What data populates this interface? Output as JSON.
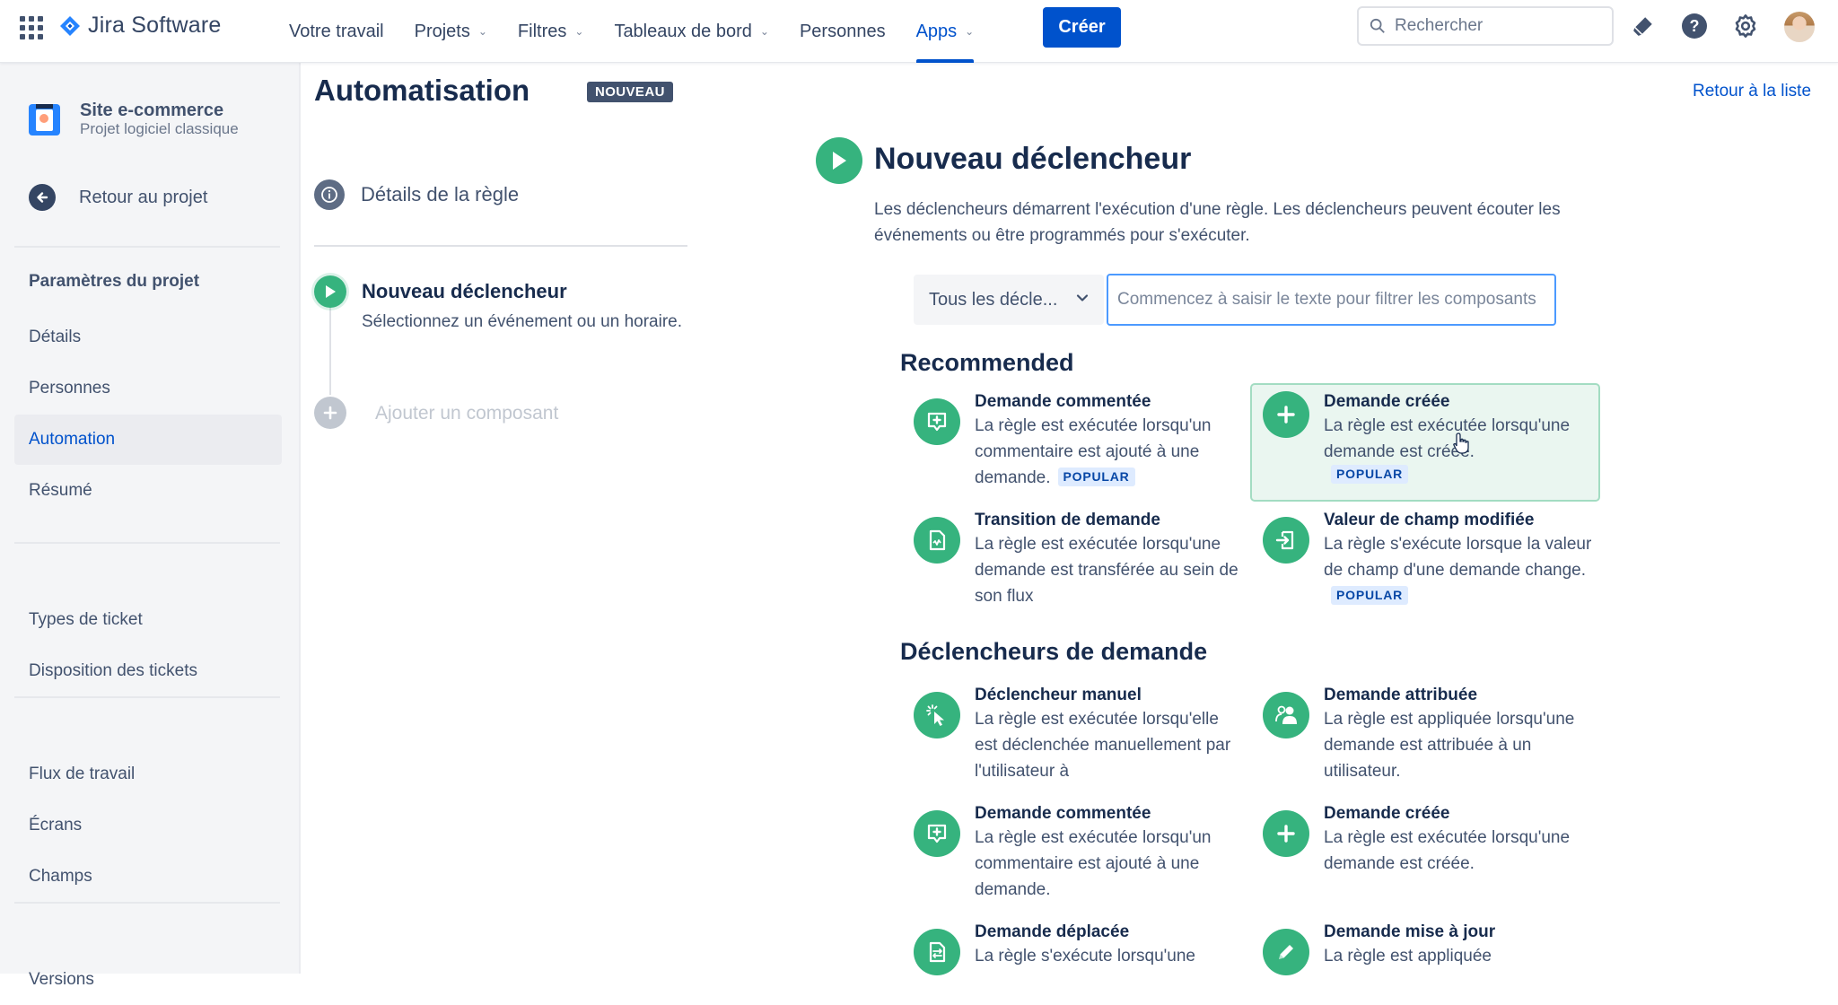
{
  "topnav": {
    "app_name": "Jira Software",
    "items": [
      {
        "label": "Votre travail",
        "dropdown": false,
        "active": false
      },
      {
        "label": "Projets",
        "dropdown": true,
        "active": false
      },
      {
        "label": "Filtres",
        "dropdown": true,
        "active": false
      },
      {
        "label": "Tableaux de bord",
        "dropdown": true,
        "active": false
      },
      {
        "label": "Personnes",
        "dropdown": false,
        "active": false
      },
      {
        "label": "Apps",
        "dropdown": true,
        "active": true
      }
    ],
    "create_label": "Créer",
    "search_placeholder": "Rechercher",
    "icons": [
      "notifications-icon",
      "help-icon",
      "settings-icon",
      "user-avatar"
    ]
  },
  "sidebar": {
    "project_name": "Site e-commerce",
    "project_type": "Projet logiciel classique",
    "back_label": "Retour au projet",
    "heading": "Paramètres du projet",
    "groups": [
      [
        {
          "label": "Détails",
          "active": false
        },
        {
          "label": "Personnes",
          "active": false
        },
        {
          "label": "Automation",
          "active": true
        },
        {
          "label": "Résumé",
          "active": false
        }
      ],
      [
        {
          "label": "Types de ticket",
          "active": false
        },
        {
          "label": "Disposition des tickets",
          "active": false
        }
      ],
      [
        {
          "label": "Flux de travail",
          "active": false
        },
        {
          "label": "Écrans",
          "active": false
        },
        {
          "label": "Champs",
          "active": false
        }
      ],
      [
        {
          "label": "Versions",
          "active": false
        }
      ]
    ]
  },
  "rule_editor": {
    "title": "Automatisation",
    "badge": "NOUVEAU",
    "details_label": "Détails de la règle",
    "trigger_step_title": "Nouveau déclencheur",
    "trigger_step_desc": "Sélectionnez un événement ou un horaire.",
    "add_component_label": "Ajouter un composant"
  },
  "main": {
    "back_to_list": "Retour à la liste",
    "title": "Nouveau déclencheur",
    "description": "Les déclencheurs démarrent l'exécution d'une règle. Les déclencheurs peuvent écouter les événements ou être programmés pour s'exécuter.",
    "filter_select_value": "Tous les décle...",
    "filter_input_value": "",
    "filter_input_placeholder": "Commencez à saisir le texte pour filtrer les composants",
    "popular_label": "POPULAR",
    "sections": [
      {
        "title": "Recommended",
        "items": [
          {
            "icon": "comment-add-icon",
            "title": "Demande commentée",
            "desc": "La règle est exécutée lorsqu'un commentaire est ajouté à une demande.",
            "popular": true,
            "hovered": false
          },
          {
            "icon": "plus-icon",
            "title": "Demande créée",
            "desc": "La règle est exécutée lorsqu'une demande est créée.",
            "popular": true,
            "hovered": true
          },
          {
            "icon": "transition-icon",
            "title": "Transition de demande",
            "desc": "La règle est exécutée lorsqu'une demande est transférée au sein de son flux",
            "popular": false,
            "hovered": false
          },
          {
            "icon": "field-change-icon",
            "title": "Valeur de champ modifiée",
            "desc": "La règle s'exécute lorsque la valeur de champ d'une demande change.",
            "popular": true,
            "hovered": false
          }
        ]
      },
      {
        "title": "Déclencheurs de demande",
        "items": [
          {
            "icon": "manual-click-icon",
            "title": "Déclencheur manuel",
            "desc": "La règle est exécutée lorsqu'elle est déclenchée manuellement par l'utilisateur à",
            "popular": false,
            "hovered": false
          },
          {
            "icon": "assign-users-icon",
            "title": "Demande attribuée",
            "desc": "La règle est appliquée lorsqu'une demande est attribuée à un utilisateur.",
            "popular": false,
            "hovered": false
          },
          {
            "icon": "comment-add-icon",
            "title": "Demande commentée",
            "desc": "La règle est exécutée lorsqu'un commentaire est ajouté à une demande.",
            "popular": false,
            "hovered": false
          },
          {
            "icon": "plus-icon",
            "title": "Demande créée",
            "desc": "La règle est exécutée lorsqu'une demande est créée.",
            "popular": false,
            "hovered": false
          },
          {
            "icon": "move-icon",
            "title": "Demande déplacée",
            "desc": "La règle s'exécute lorsqu'une",
            "popular": false,
            "hovered": false
          },
          {
            "icon": "pencil-icon",
            "title": "Demande mise à jour",
            "desc": "La règle est appliquée",
            "popular": false,
            "hovered": false
          }
        ]
      }
    ]
  },
  "colors": {
    "brand_blue": "#0052cc",
    "trigger_green": "#36b37e",
    "hover_card_bg": "#eaf6f0",
    "popular_bg": "#deebff"
  }
}
